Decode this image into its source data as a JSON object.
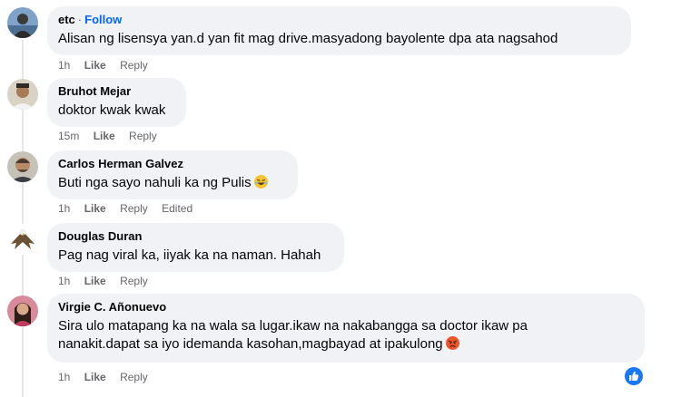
{
  "comments": [
    {
      "author": "etc",
      "follow_label": "Follow",
      "text": "Alisan ng lisensya yan.d yan fit mag drive.masyadong bayolente dpa ata nagsahod",
      "time": "1h",
      "like_label": "Like",
      "reply_label": "Reply"
    },
    {
      "author": "Bruhot Mejar",
      "text": "doktor kwak kwak",
      "time": "15m",
      "like_label": "Like",
      "reply_label": "Reply"
    },
    {
      "author": "Carlos Herman Galvez",
      "text": "Buti nga sayo nahuli ka ng Pulis",
      "emoji": "laughing-tears-emoji",
      "time": "1h",
      "like_label": "Like",
      "reply_label": "Reply",
      "edited_label": "Edited"
    },
    {
      "author": "Douglas Duran",
      "text": "Pag nag viral ka, iiyak ka na naman. Hahah",
      "time": "1h",
      "like_label": "Like",
      "reply_label": "Reply"
    },
    {
      "author": "Virgie C. Añonuevo",
      "text_line1": "Sira ulo matapang ka na wala sa lugar.ikaw na nakabangga sa doctor ikaw pa",
      "text_line2": "nanakit.dapat sa iyo idemanda kasohan,magbayad at ipakulong",
      "emoji": "angry-face-emoji",
      "time": "1h",
      "like_label": "Like",
      "reply_label": "Reply"
    }
  ],
  "reaction_icon": "like-thumb-icon",
  "colors": {
    "bubble": "#f0f2f5",
    "link_blue": "#0866ff",
    "like_blue": "#1877f2",
    "meta_gray": "#65676b"
  }
}
